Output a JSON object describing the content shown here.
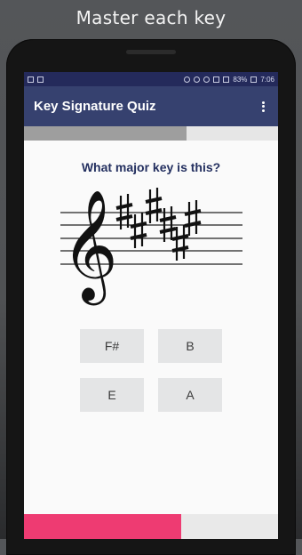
{
  "promo": {
    "caption": "Master each key"
  },
  "status_bar": {
    "battery": "83%",
    "time": "7:06"
  },
  "app_bar": {
    "title": "Key Signature Quiz"
  },
  "quiz": {
    "question": "What major key is this?",
    "key_signature": {
      "clef": "treble",
      "accidental": "sharp",
      "count": 6
    },
    "answers": [
      {
        "label": "F#"
      },
      {
        "label": "B"
      },
      {
        "label": "E"
      },
      {
        "label": "A"
      }
    ],
    "top_progress_fraction": 0.64,
    "bottom_progress_fraction": 0.62
  },
  "colors": {
    "status_bar": "#242a5b",
    "app_bar": "#36416f",
    "accent": "#ee3b72",
    "question_text": "#243060"
  }
}
